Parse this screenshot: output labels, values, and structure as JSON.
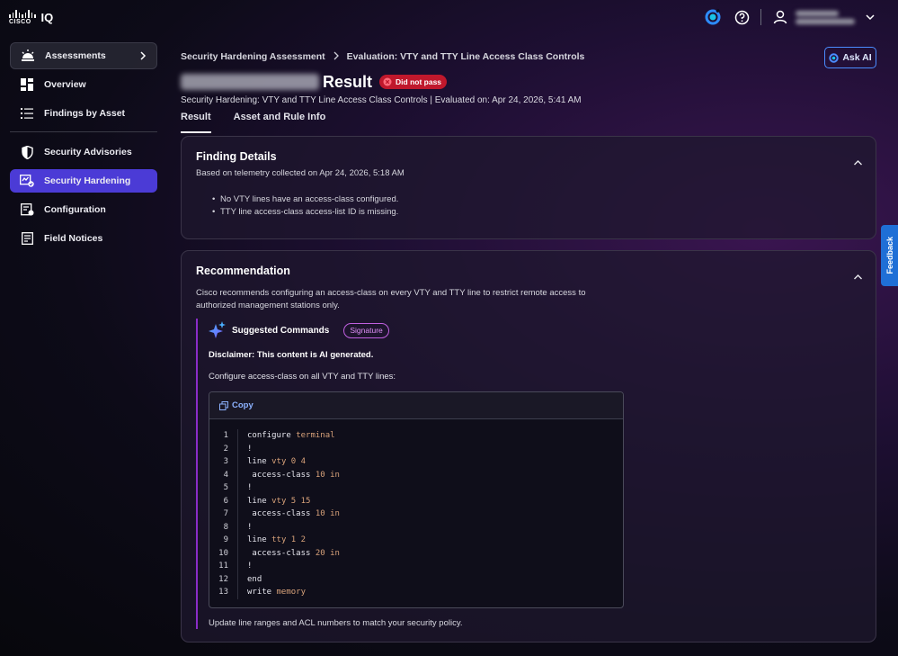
{
  "app": {
    "logo_word": "CISCO",
    "product": "IQ"
  },
  "header": {
    "icons": [
      "assistant-icon",
      "help-icon",
      "user-icon",
      "chevron-down-icon"
    ],
    "user_name": "Emily Naismith",
    "user_org": "Cisco Systems, Ltd."
  },
  "sidebar": {
    "top": {
      "label": "Assessments"
    },
    "items_group1": [
      {
        "label": "Overview"
      },
      {
        "label": "Findings by Asset"
      }
    ],
    "items_group2": [
      {
        "label": "Security Advisories"
      },
      {
        "label": "Security Hardening",
        "active": true
      },
      {
        "label": "Configuration"
      },
      {
        "label": "Field Notices"
      }
    ]
  },
  "breadcrumb": {
    "parent": "Security Hardening Assessment",
    "current": "Evaluation: VTY and TTY Line Access Class Controls"
  },
  "ask_ai": "Ask AI",
  "page": {
    "device_name": "Device_65_10_4_161",
    "title_suffix": "Result",
    "status_badge": "Did not pass",
    "subtitle": "Security Hardening: VTY and TTY Line Access Class Controls | Evaluated on: Apr 24, 2026, 5:41 AM"
  },
  "tabs": [
    {
      "label": "Result",
      "active": true
    },
    {
      "label": "Asset and Rule Info",
      "active": false
    }
  ],
  "finding": {
    "title": "Finding Details",
    "subtitle": "Based on telemetry collected on Apr 24, 2026, 5:18 AM",
    "bullets": [
      "No VTY lines have an access-class configured.",
      "TTY line access-class access-list ID is missing."
    ]
  },
  "recommendation": {
    "title": "Recommendation",
    "text": "Cisco recommends configuring an access-class on every VTY and TTY line to restrict remote access to authorized management stations only.",
    "suggested_title": "Suggested Commands",
    "signature_tag": "Signature",
    "disclaimer": "Disclaimer: This content is AI generated.",
    "intro": "Configure access-class on all VTY and TTY lines:",
    "copy_label": "Copy",
    "code": [
      {
        "kw": "configure",
        "arg": " terminal"
      },
      {
        "kw": "!",
        "arg": ""
      },
      {
        "kw": "line",
        "arg": " vty 0 4"
      },
      {
        "kw": " access-class",
        "arg": " 10 in"
      },
      {
        "kw": "!",
        "arg": ""
      },
      {
        "kw": "line",
        "arg": " vty 5 15"
      },
      {
        "kw": " access-class",
        "arg": " 10 in"
      },
      {
        "kw": "!",
        "arg": ""
      },
      {
        "kw": "line",
        "arg": " tty 1 2"
      },
      {
        "kw": " access-class",
        "arg": " 20 in"
      },
      {
        "kw": "!",
        "arg": ""
      },
      {
        "kw": "end",
        "arg": ""
      },
      {
        "kw": "write",
        "arg": " memory"
      }
    ],
    "footer": "Update line ranges and ACL numbers to match your security policy."
  },
  "feedback_tab": "Feedback",
  "colors": {
    "accent": "#4b3bd6",
    "fail": "#c0182c",
    "signature": "#c060e0",
    "ask_ai_border": "#4a8cff"
  }
}
